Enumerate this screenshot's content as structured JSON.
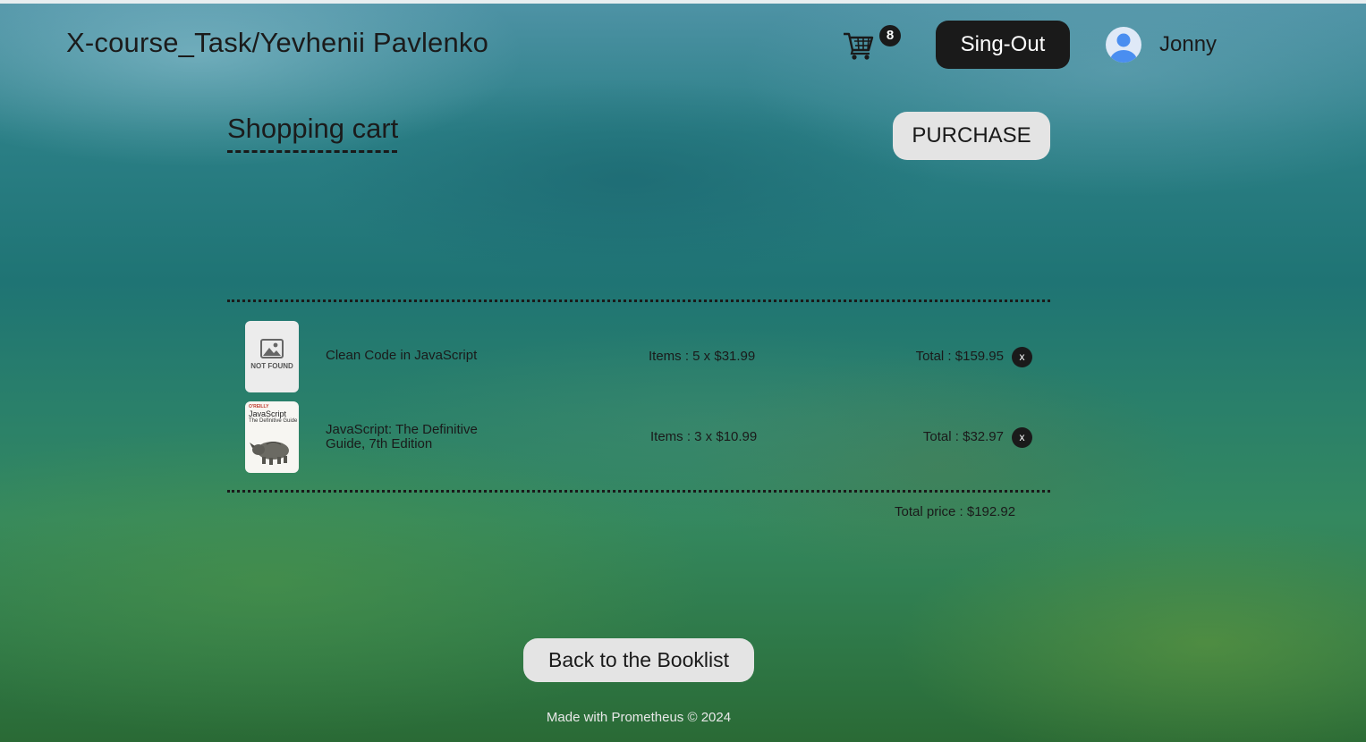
{
  "header": {
    "brand": "X-course_Task/Yevhenii Pavlenko",
    "cart_count": "8",
    "signout_label": "Sing-Out",
    "username": "Jonny"
  },
  "cart": {
    "title": "Shopping cart",
    "purchase_label": "PURCHASE",
    "items": [
      {
        "image_state": "not-found",
        "not_found_label": "NOT FOUND",
        "title": "Clean Code in JavaScript",
        "items_text": "Items : 5 x $31.99",
        "total_text": "Total : $159.95",
        "remove_label": "x"
      },
      {
        "image_state": "cover",
        "cover": {
          "brand": "O'REILLY",
          "title": "JavaScript",
          "subtitle": "The Definitive Guide"
        },
        "title": "JavaScript: The Definitive Guide, 7th Edition",
        "items_text": "Items : 3 x $10.99",
        "total_text": "Total : $32.97",
        "remove_label": "x"
      }
    ],
    "total_price_text": "Total price : $192.92"
  },
  "back_label": "Back to the Booklist",
  "footer": "Made with Prometheus © 2024",
  "icons": {
    "cart": "shopping-cart-icon",
    "avatar": "user-avatar-icon",
    "not_found": "image-placeholder-icon"
  },
  "colors": {
    "dark_button": "#1a1a1a",
    "light_button": "#e4e4e4",
    "avatar_blue": "#4a8ef0"
  }
}
